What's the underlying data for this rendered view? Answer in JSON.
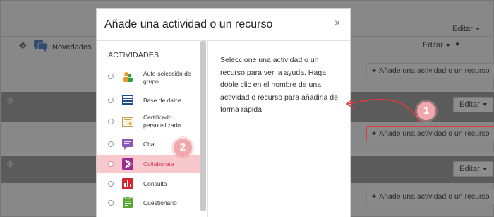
{
  "background": {
    "top_edit_label": "Editar",
    "forum_name": "Novedades",
    "forum_edit_label": "Editar",
    "add_activity_label": "Añade una actividad o un recurso",
    "section_edit_label": "Editar"
  },
  "modal": {
    "title": "Añade una actividad o un recurso",
    "close_glyph": "×",
    "list_heading": "ACTIVIDADES",
    "activities": [
      {
        "label": "Auto-selección de grupo",
        "icon": "group-self-selection-icon",
        "selected": false
      },
      {
        "label": "Base de datos",
        "icon": "database-icon",
        "selected": false
      },
      {
        "label": "Certificado personalizado",
        "icon": "certificate-icon",
        "selected": false
      },
      {
        "label": "Chat",
        "icon": "chat-icon",
        "selected": false
      },
      {
        "label": "Collaborate",
        "icon": "collaborate-icon",
        "selected": true
      },
      {
        "label": "Consulta",
        "icon": "choice-icon",
        "selected": false
      },
      {
        "label": "Cuestionario",
        "icon": "quiz-icon",
        "selected": false
      }
    ],
    "help_text": "Seleccione una actividad o un recurso para ver la ayuda. Haga doble clic en el nombre de una actividad o recurso para añadirla de forma rápida"
  },
  "annotations": {
    "step1": "1",
    "step2": "2",
    "colors": {
      "badge": "#f2a7ad",
      "arrow": "#e03b3b",
      "highlight": "#e03b3b"
    }
  }
}
